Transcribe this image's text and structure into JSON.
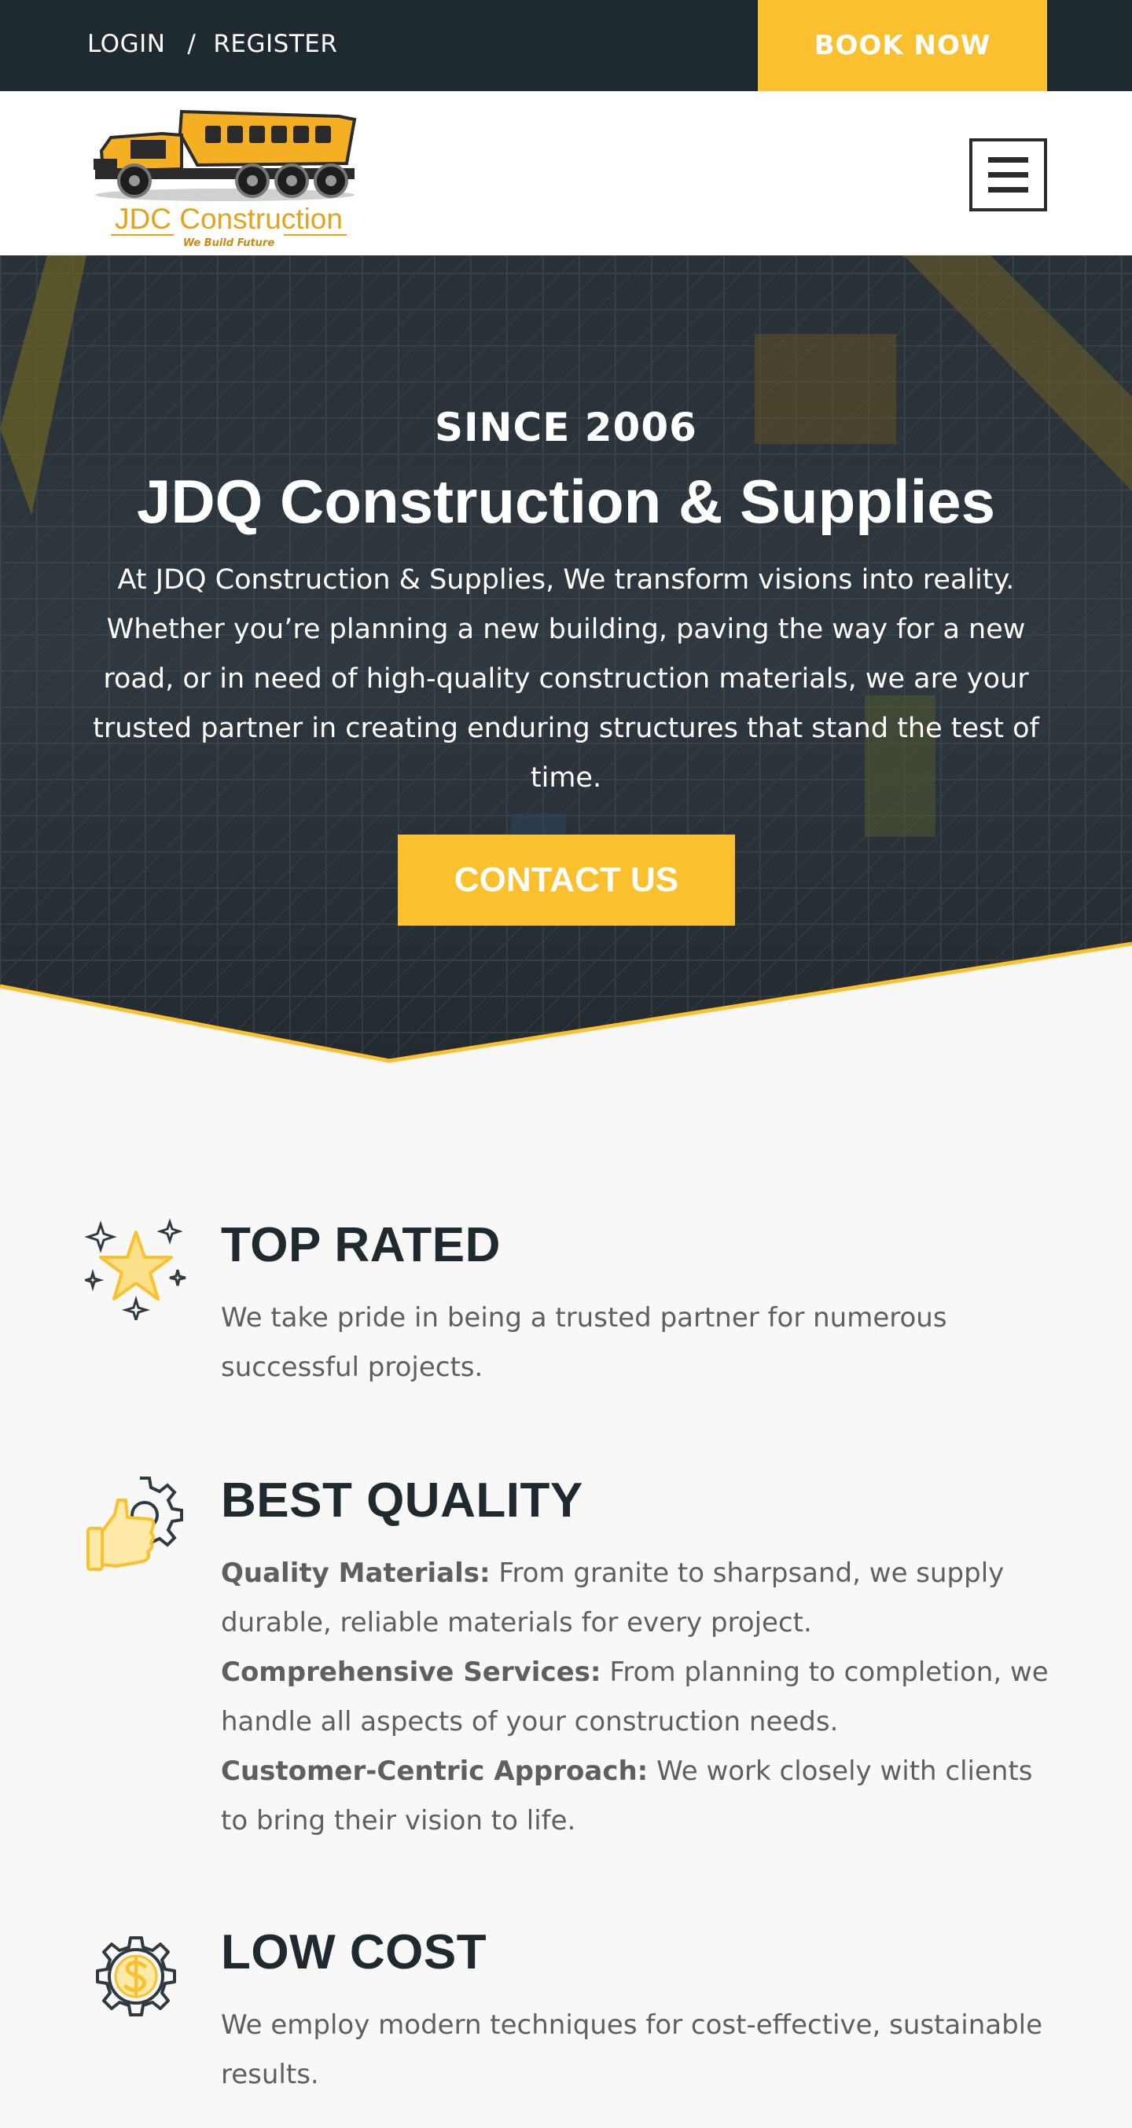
{
  "topbar": {
    "login": "LOGIN",
    "separator": "/",
    "register": "REGISTER",
    "book_now": "BOOK NOW"
  },
  "header": {
    "logo_text": "JDC Construction",
    "logo_tagline": "We Build Future",
    "menu_icon": "hamburger-icon"
  },
  "hero": {
    "since": "SINCE 2006",
    "title": "JDQ Construction & Supplies",
    "text": "At JDQ Construction & Supplies, We transform visions into reality. Whether you’re planning a new building, paving the way for a new road, or in need of high-quality construction materials, we are your trusted partner in creating enduring structures that stand the test of time.",
    "cta": "CONTACT US"
  },
  "features": [
    {
      "icon": "star-icon",
      "title": "TOP RATED",
      "body": "We take pride in being a trusted partner for numerous successful projects."
    },
    {
      "icon": "thumbs-up-gear-icon",
      "title": "BEST QUALITY",
      "items": [
        {
          "label": "Quality Materials:",
          "text": " From granite to sharpsand, we supply durable, reliable materials for every project."
        },
        {
          "label": "Comprehensive Services:",
          "text": " From planning to completion, we handle all aspects of your construction needs."
        },
        {
          "label": "Customer-Centric Approach:",
          "text": " We work closely with clients to bring their vision to life."
        }
      ]
    },
    {
      "icon": "dollar-gear-icon",
      "title": "LOW COST",
      "body": "We employ modern techniques for cost-effective, sustainable results."
    }
  ],
  "colors": {
    "accent": "#fbc02d",
    "dark": "#1f2a30",
    "background": "#f8f8f8"
  }
}
